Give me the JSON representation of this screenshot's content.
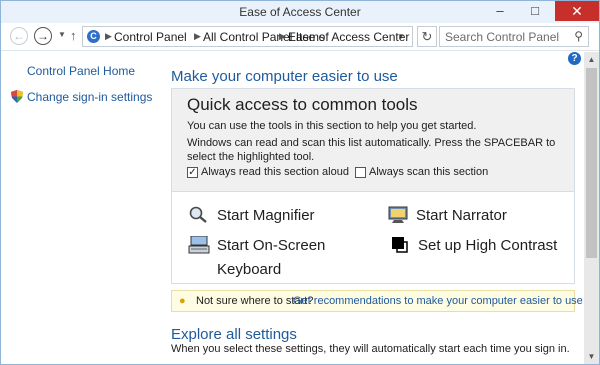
{
  "window": {
    "title": "Ease of Access Center"
  },
  "titlebar": {
    "minimize_icon": "minimize-icon",
    "maximize_icon": "maximize-icon",
    "close_icon": "close-icon",
    "close_color": "#c7302a"
  },
  "addressbar": {
    "breadcrumbs": [
      "Control Panel",
      "All Control Panel Items",
      "Ease of Access Center"
    ],
    "search_placeholder": "Search Control Panel"
  },
  "sidebar": {
    "home_label": "Control Panel Home",
    "signin_label": "Change sign-in settings"
  },
  "main": {
    "heading": "Make your computer easier to use",
    "help_glyph": "?",
    "quick": {
      "title": "Quick access to common tools",
      "desc": "You can use the tools in this section to help you get started.",
      "scan_info": "Windows can read and scan this list automatically.  Press the SPACEBAR to select the highlighted tool.",
      "read_aloud": {
        "label": "Always read this section aloud",
        "checked": true
      },
      "scan": {
        "label": "Always scan this section",
        "checked": false
      }
    },
    "tools": {
      "magnifier": "Start Magnifier",
      "narrator": "Start Narrator",
      "osk_line1": "Start On-Screen",
      "osk_line2": "Keyboard",
      "contrast": "Set up High Contrast"
    },
    "tip": {
      "question": "Not sure where to start?",
      "link": "Get recommendations to make your computer easier to use"
    },
    "explore": {
      "title": "Explore all settings",
      "desc": "When you select these settings, they will automatically start each time you sign in."
    }
  },
  "colors": {
    "link": "#1e5a9c",
    "accent": "#1e6ac5",
    "tip_bg": "#fffce4"
  }
}
